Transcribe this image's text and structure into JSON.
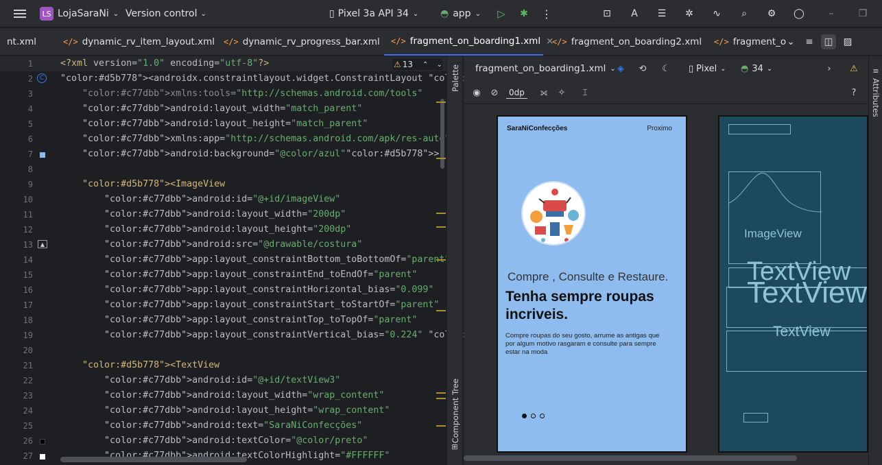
{
  "titlebar": {
    "project_badge": "LS",
    "project": "LojaSaraNi",
    "vcs": "Version control",
    "device": "Pixel 3a API 34",
    "run_config": "app"
  },
  "tabs": [
    {
      "label": "nt.xml"
    },
    {
      "label": "dynamic_rv_item_layout.xml"
    },
    {
      "label": "dynamic_rv_progress_bar.xml"
    },
    {
      "label": "fragment_on_boarding1.xml"
    },
    {
      "label": "fragment_on_boarding2.xml"
    },
    {
      "label": "fragment_o"
    }
  ],
  "editor": {
    "warnings_count": "13",
    "line_numbers": [
      "1",
      "2",
      "3",
      "4",
      "5",
      "6",
      "7",
      "8",
      "9",
      "10",
      "11",
      "12",
      "13",
      "14",
      "15",
      "16",
      "17",
      "18",
      "19",
      "20",
      "21",
      "22",
      "23",
      "24",
      "25",
      "26",
      "27"
    ],
    "lines": [
      "<?xml version=\"1.0\" encoding=\"utf-8\"?>",
      "<androidx.constraintlayout.widget.ConstraintLayout xmlns:android=\"http",
      "    xmlns:tools=\"http://schemas.android.com/tools\"",
      "    android:layout_width=\"match_parent\"",
      "    android:layout_height=\"match_parent\"",
      "    xmlns:app=\"http://schemas.android.com/apk/res-auto\"",
      "    android:background=\"@color/azul\">",
      "",
      "    <ImageView",
      "        android:id=\"@+id/imageView\"",
      "        android:layout_width=\"200dp\"",
      "        android:layout_height=\"200dp\"",
      "        android:src=\"@drawable/costura\"",
      "        app:layout_constraintBottom_toBottomOf=\"parent\"",
      "        app:layout_constraintEnd_toEndOf=\"parent\"",
      "        app:layout_constraintHorizontal_bias=\"0.099\"",
      "        app:layout_constraintStart_toStartOf=\"parent\"",
      "        app:layout_constraintTop_toTopOf=\"parent\"",
      "        app:layout_constraintVertical_bias=\"0.224\" />",
      "",
      "    <TextView",
      "        android:id=\"@+id/textView3\"",
      "        android:layout_width=\"wrap_content\"",
      "        android:layout_height=\"wrap_content\"",
      "        android:text=\"SaraNiConfecções\"",
      "        android:textColor=\"@color/preto\"",
      "        android:textColorHighlight=\"#FFFFFF\""
    ]
  },
  "side_panels": {
    "palette": "Palette",
    "component_tree": "Component Tree",
    "attributes": "Attributes"
  },
  "design": {
    "file": "fragment_on_boarding1.xml",
    "device": "Pixel",
    "api": "34",
    "margin": "0dp"
  },
  "preview": {
    "brand": "SaraNiConfecções",
    "next": "Proximo",
    "subtitle": "Compre , Consulte e Restaure.",
    "headline": "Tenha sempre roupas incriveis.",
    "body": "Compre roupas do seu gosto, arrume as antigas que por algum motivo rasgaram e consulte para sempre estar na moda"
  },
  "blueprint": {
    "image_label": "ImageView",
    "text1": "TextView",
    "text2": "TextView",
    "text3": "TextView"
  },
  "colors": {
    "preview_bg": "#8fbcee",
    "blueprint_bg": "#1c4a5c",
    "accent": "#3574f0"
  }
}
